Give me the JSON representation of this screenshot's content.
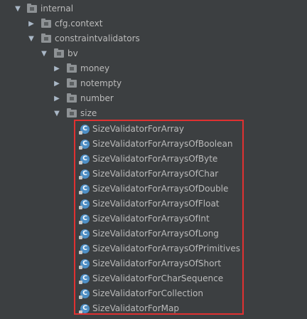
{
  "tree": {
    "internal": {
      "label": "internal",
      "expanded_glyph": "▼"
    },
    "cfg_context": {
      "label": "cfg.context",
      "collapsed_glyph": "▶"
    },
    "constraintvalidators": {
      "label": "constraintvalidators",
      "expanded_glyph": "▼"
    },
    "bv": {
      "label": "bv",
      "expanded_glyph": "▼"
    },
    "money": {
      "label": "money",
      "collapsed_glyph": "▶"
    },
    "notempty": {
      "label": "notempty",
      "collapsed_glyph": "▶"
    },
    "number": {
      "label": "number",
      "collapsed_glyph": "▶"
    },
    "size": {
      "label": "size",
      "expanded_glyph": "▼"
    },
    "classes": [
      "SizeValidatorForArray",
      "SizeValidatorForArraysOfBoolean",
      "SizeValidatorForArraysOfByte",
      "SizeValidatorForArraysOfChar",
      "SizeValidatorForArraysOfDouble",
      "SizeValidatorForArraysOfFloat",
      "SizeValidatorForArraysOfInt",
      "SizeValidatorForArraysOfLong",
      "SizeValidatorForArraysOfPrimitives",
      "SizeValidatorForArraysOfShort",
      "SizeValidatorForCharSequence",
      "SizeValidatorForCollection",
      "SizeValidatorForMap"
    ],
    "class_icon_letter": "C"
  },
  "colors": {
    "background": "#3c3f41",
    "text": "#bbbbbb",
    "highlight_border": "#e03131",
    "class_icon": "#4f8fc5"
  }
}
